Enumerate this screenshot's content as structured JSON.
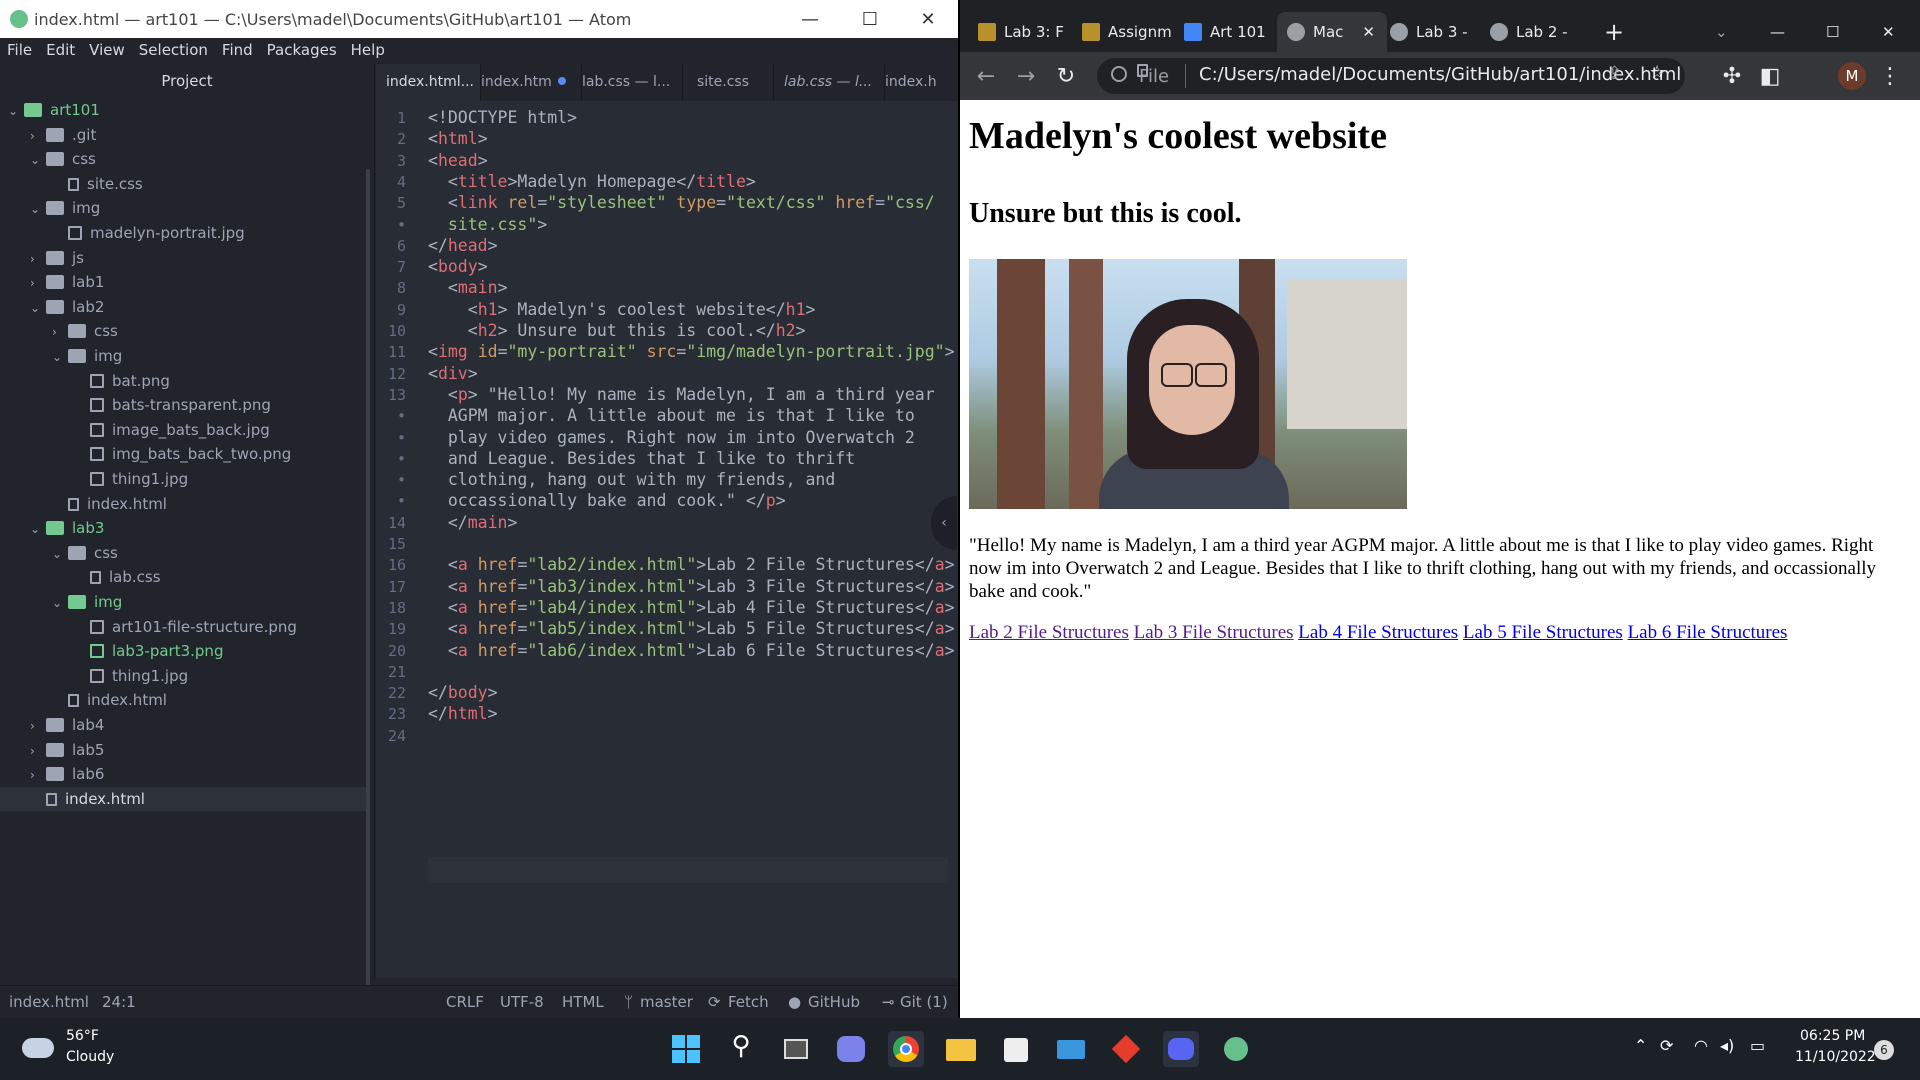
{
  "atom": {
    "title": "index.html — art101 — C:\\Users\\madel\\Documents\\GitHub\\art101 — Atom",
    "menu": [
      "File",
      "Edit",
      "View",
      "Selection",
      "Find",
      "Packages",
      "Help"
    ],
    "project_label": "Project",
    "tree": [
      {
        "label": "art101",
        "depth": 0,
        "type": "repo",
        "open": true,
        "color": "green"
      },
      {
        "label": ".git",
        "depth": 1,
        "type": "folder",
        "open": false,
        "color": "dim"
      },
      {
        "label": "css",
        "depth": 1,
        "type": "folder",
        "open": true
      },
      {
        "label": "site.css",
        "depth": 2,
        "type": "file"
      },
      {
        "label": "img",
        "depth": 1,
        "type": "folder",
        "open": true
      },
      {
        "label": "madelyn-portrait.jpg",
        "depth": 2,
        "type": "image"
      },
      {
        "label": "js",
        "depth": 1,
        "type": "folder",
        "open": false
      },
      {
        "label": "lab1",
        "depth": 1,
        "type": "folder",
        "open": false
      },
      {
        "label": "lab2",
        "depth": 1,
        "type": "folder",
        "open": true
      },
      {
        "label": "css",
        "depth": 2,
        "type": "folder",
        "open": false
      },
      {
        "label": "img",
        "depth": 2,
        "type": "folder",
        "open": true
      },
      {
        "label": "bat.png",
        "depth": 3,
        "type": "image"
      },
      {
        "label": "bats-transparent.png",
        "depth": 3,
        "type": "image"
      },
      {
        "label": "image_bats_back.jpg",
        "depth": 3,
        "type": "image"
      },
      {
        "label": "img_bats_back_two.png",
        "depth": 3,
        "type": "image"
      },
      {
        "label": "thing1.jpg",
        "depth": 3,
        "type": "image"
      },
      {
        "label": "index.html",
        "depth": 2,
        "type": "file"
      },
      {
        "label": "lab3",
        "depth": 1,
        "type": "folder",
        "open": true,
        "color": "green"
      },
      {
        "label": "css",
        "depth": 2,
        "type": "folder",
        "open": true
      },
      {
        "label": "lab.css",
        "depth": 3,
        "type": "file"
      },
      {
        "label": "img",
        "depth": 2,
        "type": "folder",
        "open": true,
        "color": "green"
      },
      {
        "label": "art101-file-structure.png",
        "depth": 3,
        "type": "image"
      },
      {
        "label": "lab3-part3.png",
        "depth": 3,
        "type": "image",
        "color": "green"
      },
      {
        "label": "thing1.jpg",
        "depth": 3,
        "type": "image"
      },
      {
        "label": "index.html",
        "depth": 2,
        "type": "file"
      },
      {
        "label": "lab4",
        "depth": 1,
        "type": "folder",
        "open": false
      },
      {
        "label": "lab5",
        "depth": 1,
        "type": "folder",
        "open": false
      },
      {
        "label": "lab6",
        "depth": 1,
        "type": "folder",
        "open": false
      },
      {
        "label": "index.html",
        "depth": 1,
        "type": "file",
        "selected": true
      }
    ],
    "tabs": [
      {
        "label": "index.html...",
        "active": true
      },
      {
        "label": "index.htm",
        "modified": true
      },
      {
        "label": "lab.css — l..."
      },
      {
        "label": "site.css"
      },
      {
        "label": "lab.css — l..."
      },
      {
        "label": "index.h"
      }
    ],
    "code_lines": [
      {
        "n": "1",
        "html": "<span class='b'>&lt;!DOCTYPE html&gt;</span>"
      },
      {
        "n": "2",
        "html": "<span class='b'>&lt;</span><span class='t'>html</span><span class='b'>&gt;</span>"
      },
      {
        "n": "3",
        "html": "<span class='b'>&lt;</span><span class='t'>head</span><span class='b'>&gt;</span>"
      },
      {
        "n": "4",
        "html": "  <span class='b'>&lt;</span><span class='t'>title</span><span class='b'>&gt;Madelyn Homepage&lt;/</span><span class='t'>title</span><span class='b'>&gt;</span>"
      },
      {
        "n": "5",
        "html": "  <span class='b'>&lt;</span><span class='t'>link</span> <span class='a'>rel</span>=<span class='s'>\"stylesheet\"</span> <span class='a'>type</span>=<span class='s'>\"text/css\"</span> <span class='a'>href</span>=<span class='s'>\"css/</span>"
      },
      {
        "n": "•",
        "html": "  <span class='s'>site.css\"</span><span class='b'>&gt;</span>"
      },
      {
        "n": "6",
        "html": "<span class='b'>&lt;/</span><span class='t'>head</span><span class='b'>&gt;</span>"
      },
      {
        "n": "7",
        "html": "<span class='b'>&lt;</span><span class='t'>body</span><span class='b'>&gt;</span>"
      },
      {
        "n": "8",
        "html": "  <span class='b'>&lt;</span><span class='t'>main</span><span class='b'>&gt;</span>"
      },
      {
        "n": "9",
        "html": "    <span class='b'>&lt;</span><span class='t'>h1</span><span class='b'>&gt; Madelyn's coolest website&lt;/</span><span class='t'>h1</span><span class='b'>&gt;</span>"
      },
      {
        "n": "10",
        "html": "    <span class='b'>&lt;</span><span class='t'>h2</span><span class='b'>&gt; Unsure but this is cool.&lt;/</span><span class='t'>h2</span><span class='b'>&gt;</span>"
      },
      {
        "n": "11",
        "html": "<span class='b'>&lt;</span><span class='t'>img</span> <span class='a'>id</span>=<span class='s'>\"my-portrait\"</span> <span class='a'>src</span>=<span class='s'>\"img/madelyn-portrait.jpg\"</span><span class='b'>&gt;</span>"
      },
      {
        "n": "12",
        "html": "<span class='b'>&lt;</span><span class='t'>div</span><span class='b'>&gt;</span>"
      },
      {
        "n": "13",
        "html": "  <span class='b'>&lt;</span><span class='t'>p</span><span class='b'>&gt; \"Hello! My name is Madelyn, I am a third year</span>"
      },
      {
        "n": "•",
        "html": "  <span class='b'>AGPM major. A little about me is that I like to</span>"
      },
      {
        "n": "•",
        "html": "  <span class='b'>play video games. Right now im into Overwatch 2</span>"
      },
      {
        "n": "•",
        "html": "  <span class='b'>and League. Besides that I like to thrift</span>"
      },
      {
        "n": "•",
        "html": "  <span class='b'>clothing, hang out with my friends, and</span>"
      },
      {
        "n": "•",
        "html": "  <span class='b'>occassionally bake and cook.\" &lt;/</span><span class='t'>p</span><span class='b'>&gt;</span>"
      },
      {
        "n": "14",
        "html": "  <span class='b'>&lt;/</span><span class='t'>main</span><span class='b'>&gt;</span>"
      },
      {
        "n": "15",
        "html": ""
      },
      {
        "n": "16",
        "html": "  <span class='b'>&lt;</span><span class='t'>a</span> <span class='a'>href</span>=<span class='s'>\"lab2/index.html\"</span><span class='b'>&gt;Lab 2 File Structures&lt;/</span><span class='t'>a</span><span class='b'>&gt;</span>"
      },
      {
        "n": "17",
        "html": "  <span class='b'>&lt;</span><span class='t'>a</span> <span class='a'>href</span>=<span class='s'>\"lab3/index.html\"</span><span class='b'>&gt;Lab 3 File Structures&lt;/</span><span class='t'>a</span><span class='b'>&gt;</span>"
      },
      {
        "n": "18",
        "html": "  <span class='b'>&lt;</span><span class='t'>a</span> <span class='a'>href</span>=<span class='s'>\"lab4/index.html\"</span><span class='b'>&gt;Lab 4 File Structures&lt;/</span><span class='t'>a</span><span class='b'>&gt;</span>"
      },
      {
        "n": "19",
        "html": "  <span class='b'>&lt;</span><span class='t'>a</span> <span class='a'>href</span>=<span class='s'>\"lab5/index.html\"</span><span class='b'>&gt;Lab 5 File Structures&lt;/</span><span class='t'>a</span><span class='b'>&gt;</span>"
      },
      {
        "n": "20",
        "html": "  <span class='b'>&lt;</span><span class='t'>a</span> <span class='a'>href</span>=<span class='s'>\"lab6/index.html\"</span><span class='b'>&gt;Lab 6 File Structures&lt;/</span><span class='t'>a</span><span class='b'>&gt;</span>"
      },
      {
        "n": "21",
        "html": ""
      },
      {
        "n": "22",
        "html": "<span class='b'>&lt;/</span><span class='t'>body</span><span class='b'>&gt;</span>"
      },
      {
        "n": "23",
        "html": "<span class='b'>&lt;/</span><span class='t'>html</span><span class='b'>&gt;</span>"
      },
      {
        "n": "24",
        "html": ""
      }
    ],
    "status": {
      "file": "index.html",
      "cursor": "24:1",
      "line_ending": "CRLF",
      "encoding": "UTF-8",
      "grammar": "HTML",
      "branch": "master",
      "fetch": "Fetch",
      "github": "GitHub",
      "git": "Git (1)"
    }
  },
  "chrome": {
    "tabs": [
      {
        "label": "Lab 3: F",
        "icon": "ucsc",
        "active": false
      },
      {
        "label": "Assignm",
        "icon": "ucsc",
        "active": false
      },
      {
        "label": "Art 101",
        "icon": "docs",
        "active": false
      },
      {
        "label": "Mac",
        "icon": "globe",
        "active": true
      },
      {
        "label": "Lab 3 -",
        "icon": "globe",
        "active": false
      },
      {
        "label": "Lab 2 -",
        "icon": "globe",
        "active": false
      }
    ],
    "address": {
      "scheme_label": "File",
      "url": "C:/Users/madel/Documents/GitHub/art101/index.html"
    },
    "profile_initial": "M",
    "page": {
      "h1": "Madelyn's coolest website",
      "h2": "Unsure but this is cool.",
      "paragraph": "\"Hello! My name is Madelyn, I am a third year AGPM major. A little about me is that I like to play video games. Right now im into Overwatch 2 and League. Besides that I like to thrift clothing, hang out with my friends, and occassionally bake and cook.\"",
      "links": [
        {
          "label": "Lab 2 File Structures",
          "visited": true
        },
        {
          "label": "Lab 3 File Structures",
          "visited": true
        },
        {
          "label": "Lab 4 File Structures",
          "visited": false
        },
        {
          "label": "Lab 5 File Structures",
          "visited": false
        },
        {
          "label": "Lab 6 File Structures",
          "visited": false
        }
      ]
    }
  },
  "taskbar": {
    "weather_temp": "56°F",
    "weather_desc": "Cloudy",
    "time": "06:25 PM",
    "date": "11/10/2022",
    "notif_count": "6"
  }
}
